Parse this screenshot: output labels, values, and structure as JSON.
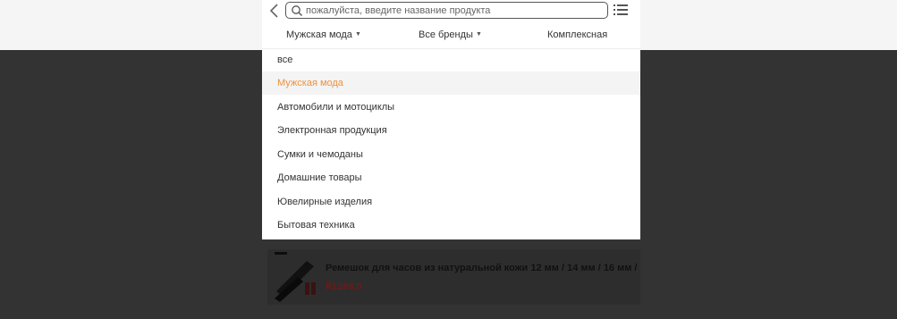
{
  "search": {
    "placeholder": "пожалуйста, введите название продукта"
  },
  "filters": [
    {
      "label": "Мужская мода",
      "has_dropdown": true
    },
    {
      "label": "Все бренды",
      "has_dropdown": true
    },
    {
      "label": "Комплексная",
      "has_dropdown": false
    }
  ],
  "category_menu": {
    "selected": "Мужская мода",
    "items": [
      {
        "label": "все"
      },
      {
        "label": "Мужская мода"
      },
      {
        "label": "Автомобили и мотоциклы"
      },
      {
        "label": "Электронная продукция"
      },
      {
        "label": "Сумки и чемоданы"
      },
      {
        "label": "Домашние товары"
      },
      {
        "label": "Ювелирные изделия"
      },
      {
        "label": "Бытовая техника"
      }
    ]
  },
  "product": {
    "title": "Ремешок для часов из натуральной кожи 12 мм / 14 мм / 16 мм /",
    "price": "₽1288.0"
  },
  "colors": {
    "accent": "#f0913c",
    "overlay": "#333333",
    "price": "#6b1a1a"
  },
  "icons": [
    "back-arrow-icon",
    "search-icon",
    "list-view-icon",
    "caret-down-icon"
  ]
}
